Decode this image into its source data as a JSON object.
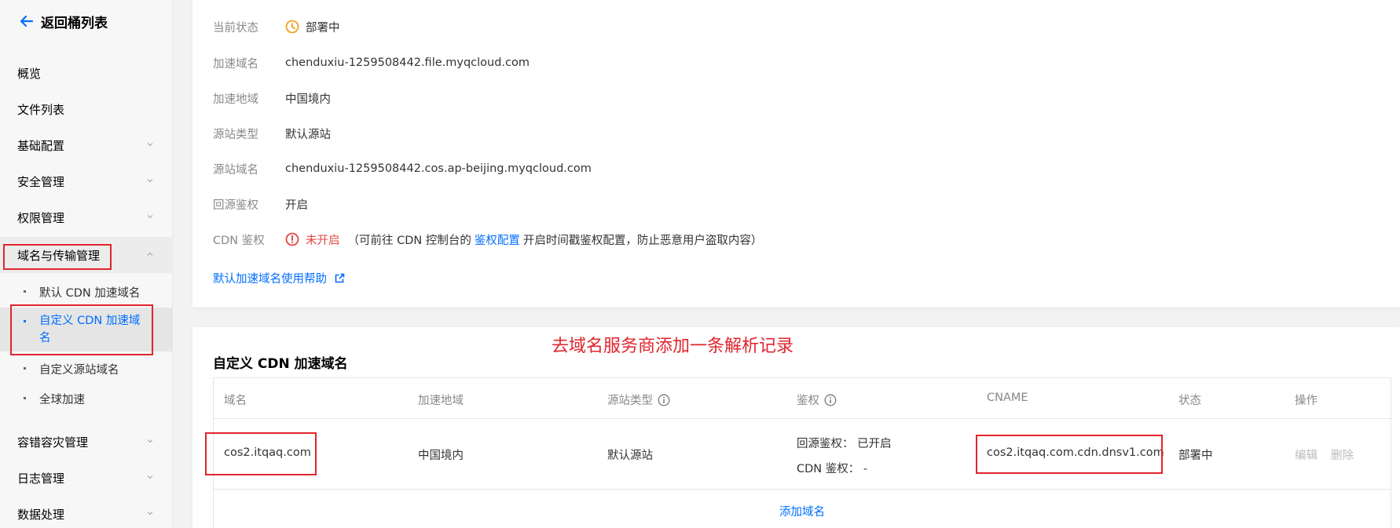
{
  "sidebar": {
    "back_label": "返回桶列表",
    "items": [
      {
        "label": "概览",
        "has_chevron": false
      },
      {
        "label": "文件列表",
        "has_chevron": false
      },
      {
        "label": "基础配置",
        "has_chevron": true
      },
      {
        "label": "安全管理",
        "has_chevron": true
      },
      {
        "label": "权限管理",
        "has_chevron": true
      },
      {
        "label": "域名与传输管理",
        "has_chevron": true,
        "expanded": true
      },
      {
        "label": "容错容灾管理",
        "has_chevron": true
      },
      {
        "label": "日志管理",
        "has_chevron": true
      },
      {
        "label": "数据处理",
        "has_chevron": true
      }
    ],
    "subitems": [
      {
        "label": "默认 CDN 加速域名"
      },
      {
        "label": "自定义 CDN 加速域名",
        "selected": true
      },
      {
        "label": "自定义源站域名"
      },
      {
        "label": "全球加速"
      }
    ]
  },
  "default_cdn": {
    "fields": [
      {
        "label": "当前状态",
        "value": "部署中",
        "icon": "clock-warning-icon"
      },
      {
        "label": "加速域名",
        "value": "chenduxiu-1259508442.file.myqcloud.com"
      },
      {
        "label": "加速地域",
        "value": "中国境内"
      },
      {
        "label": "源站类型",
        "value": "默认源站"
      },
      {
        "label": "源站域名",
        "value": "chenduxiu-1259508442.cos.ap-beijing.myqcloud.com"
      },
      {
        "label": "回源鉴权",
        "value": "开启"
      }
    ],
    "cdn_auth": {
      "label": "CDN 鉴权",
      "status": "未开启",
      "note_prefix": "（可前往 CDN 控制台的",
      "link": "鉴权配置",
      "note_suffix": "开启时间戳鉴权配置，防止恶意用户盗取内容）"
    },
    "help_link": "默认加速域名使用帮助"
  },
  "custom_cdn": {
    "title": "自定义 CDN 加速域名",
    "annotation": "去域名服务商添加一条解析记录",
    "columns": [
      "域名",
      "加速地域",
      "源站类型",
      "鉴权",
      "CNAME",
      "状态",
      "操作"
    ],
    "row": {
      "domain": "cos2.itqaq.com",
      "region": "中国境内",
      "origin_type": "默认源站",
      "auth_origin": "回源鉴权： 已开启",
      "auth_cdn": "CDN 鉴权： -",
      "cname": "cos2.itqaq.com.cdn.dnsv1.com",
      "status": "部署中",
      "action_edit": "编辑",
      "action_delete": "删除"
    },
    "add_label": "添加域名"
  },
  "colors": {
    "accent": "#006eff",
    "highlight": "#e0242c",
    "warning": "#f0a020",
    "error": "#e54545"
  }
}
